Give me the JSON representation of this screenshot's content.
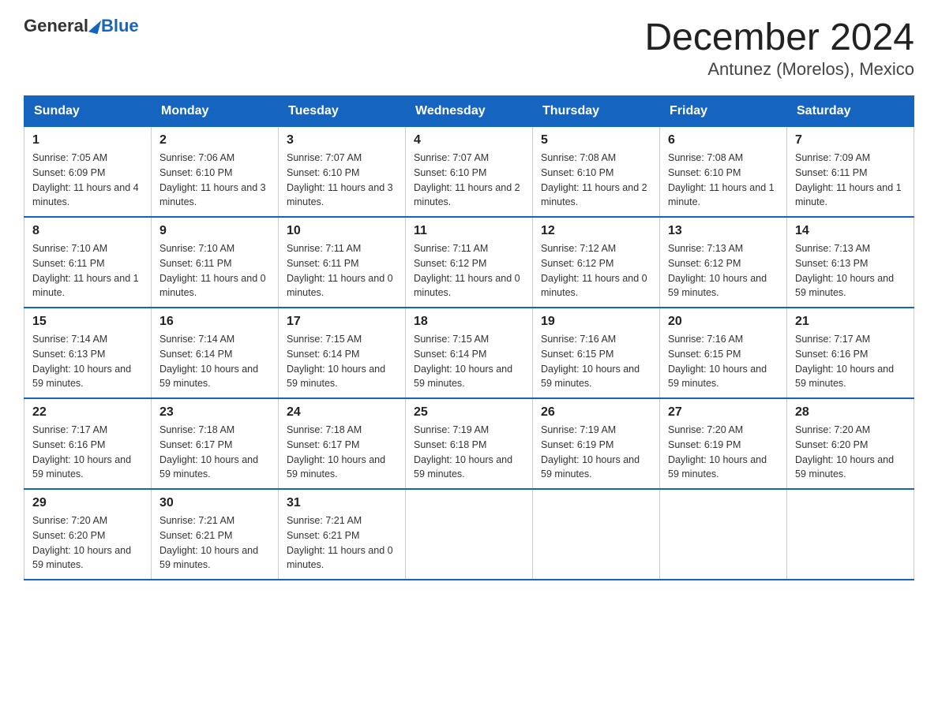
{
  "header": {
    "logo_general": "General",
    "logo_blue": "Blue",
    "title": "December 2024",
    "subtitle": "Antunez (Morelos), Mexico"
  },
  "days_of_week": [
    "Sunday",
    "Monday",
    "Tuesday",
    "Wednesday",
    "Thursday",
    "Friday",
    "Saturday"
  ],
  "weeks": [
    [
      {
        "day": "1",
        "sunrise": "7:05 AM",
        "sunset": "6:09 PM",
        "daylight": "11 hours and 4 minutes."
      },
      {
        "day": "2",
        "sunrise": "7:06 AM",
        "sunset": "6:10 PM",
        "daylight": "11 hours and 3 minutes."
      },
      {
        "day": "3",
        "sunrise": "7:07 AM",
        "sunset": "6:10 PM",
        "daylight": "11 hours and 3 minutes."
      },
      {
        "day": "4",
        "sunrise": "7:07 AM",
        "sunset": "6:10 PM",
        "daylight": "11 hours and 2 minutes."
      },
      {
        "day": "5",
        "sunrise": "7:08 AM",
        "sunset": "6:10 PM",
        "daylight": "11 hours and 2 minutes."
      },
      {
        "day": "6",
        "sunrise": "7:08 AM",
        "sunset": "6:10 PM",
        "daylight": "11 hours and 1 minute."
      },
      {
        "day": "7",
        "sunrise": "7:09 AM",
        "sunset": "6:11 PM",
        "daylight": "11 hours and 1 minute."
      }
    ],
    [
      {
        "day": "8",
        "sunrise": "7:10 AM",
        "sunset": "6:11 PM",
        "daylight": "11 hours and 1 minute."
      },
      {
        "day": "9",
        "sunrise": "7:10 AM",
        "sunset": "6:11 PM",
        "daylight": "11 hours and 0 minutes."
      },
      {
        "day": "10",
        "sunrise": "7:11 AM",
        "sunset": "6:11 PM",
        "daylight": "11 hours and 0 minutes."
      },
      {
        "day": "11",
        "sunrise": "7:11 AM",
        "sunset": "6:12 PM",
        "daylight": "11 hours and 0 minutes."
      },
      {
        "day": "12",
        "sunrise": "7:12 AM",
        "sunset": "6:12 PM",
        "daylight": "11 hours and 0 minutes."
      },
      {
        "day": "13",
        "sunrise": "7:13 AM",
        "sunset": "6:12 PM",
        "daylight": "10 hours and 59 minutes."
      },
      {
        "day": "14",
        "sunrise": "7:13 AM",
        "sunset": "6:13 PM",
        "daylight": "10 hours and 59 minutes."
      }
    ],
    [
      {
        "day": "15",
        "sunrise": "7:14 AM",
        "sunset": "6:13 PM",
        "daylight": "10 hours and 59 minutes."
      },
      {
        "day": "16",
        "sunrise": "7:14 AM",
        "sunset": "6:14 PM",
        "daylight": "10 hours and 59 minutes."
      },
      {
        "day": "17",
        "sunrise": "7:15 AM",
        "sunset": "6:14 PM",
        "daylight": "10 hours and 59 minutes."
      },
      {
        "day": "18",
        "sunrise": "7:15 AM",
        "sunset": "6:14 PM",
        "daylight": "10 hours and 59 minutes."
      },
      {
        "day": "19",
        "sunrise": "7:16 AM",
        "sunset": "6:15 PM",
        "daylight": "10 hours and 59 minutes."
      },
      {
        "day": "20",
        "sunrise": "7:16 AM",
        "sunset": "6:15 PM",
        "daylight": "10 hours and 59 minutes."
      },
      {
        "day": "21",
        "sunrise": "7:17 AM",
        "sunset": "6:16 PM",
        "daylight": "10 hours and 59 minutes."
      }
    ],
    [
      {
        "day": "22",
        "sunrise": "7:17 AM",
        "sunset": "6:16 PM",
        "daylight": "10 hours and 59 minutes."
      },
      {
        "day": "23",
        "sunrise": "7:18 AM",
        "sunset": "6:17 PM",
        "daylight": "10 hours and 59 minutes."
      },
      {
        "day": "24",
        "sunrise": "7:18 AM",
        "sunset": "6:17 PM",
        "daylight": "10 hours and 59 minutes."
      },
      {
        "day": "25",
        "sunrise": "7:19 AM",
        "sunset": "6:18 PM",
        "daylight": "10 hours and 59 minutes."
      },
      {
        "day": "26",
        "sunrise": "7:19 AM",
        "sunset": "6:19 PM",
        "daylight": "10 hours and 59 minutes."
      },
      {
        "day": "27",
        "sunrise": "7:20 AM",
        "sunset": "6:19 PM",
        "daylight": "10 hours and 59 minutes."
      },
      {
        "day": "28",
        "sunrise": "7:20 AM",
        "sunset": "6:20 PM",
        "daylight": "10 hours and 59 minutes."
      }
    ],
    [
      {
        "day": "29",
        "sunrise": "7:20 AM",
        "sunset": "6:20 PM",
        "daylight": "10 hours and 59 minutes."
      },
      {
        "day": "30",
        "sunrise": "7:21 AM",
        "sunset": "6:21 PM",
        "daylight": "10 hours and 59 minutes."
      },
      {
        "day": "31",
        "sunrise": "7:21 AM",
        "sunset": "6:21 PM",
        "daylight": "11 hours and 0 minutes."
      },
      null,
      null,
      null,
      null
    ]
  ]
}
